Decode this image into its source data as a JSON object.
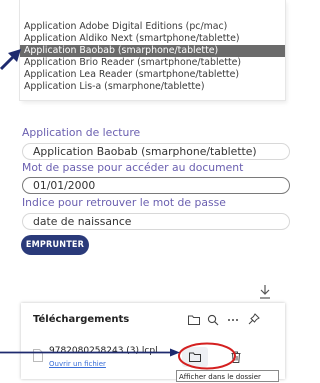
{
  "app_list": {
    "options": [
      "Application Adobe Digital Editions (pc/mac)",
      "Application Aldiko Next (smartphone/tablette)",
      "Application Baobab (smarphone/tablette)",
      "Application Brio Reader (smartphone/tablette)",
      "Application Lea Reader (smartphone/tablette)",
      "Application Lis-a (smarphone/tablette)"
    ],
    "selected_index": 2
  },
  "form": {
    "app_label": "Application de lecture",
    "app_value": "Application Baobab (smarphone/tablette)",
    "password_label": "Mot de passe pour accéder au document",
    "password_value": "01/01/2000",
    "hint_label": "Indice pour retrouver le mot de passe",
    "hint_value": "date de naissance",
    "borrow_button": "EMPRUNTER"
  },
  "downloads": {
    "title": "Téléchargements",
    "file_name": "9782080258243 (3).lcpl",
    "open_file": "Ouvrir un fichier",
    "tooltip": "Afficher dans le dossier"
  },
  "colors": {
    "selected_option_bg": "#6b6b6b",
    "label_color": "#6a5fb0",
    "button_bg": "#2a3a7a",
    "link_color": "#3a6fd8",
    "annotation_red": "#d42020",
    "arrow_navy": "#1e2a6e"
  },
  "icons": [
    "arrow-pointer-icon",
    "download-arrow-icon",
    "folder-icon",
    "search-icon",
    "more-icon",
    "pin-icon",
    "file-icon",
    "open-folder-icon",
    "trash-icon"
  ]
}
